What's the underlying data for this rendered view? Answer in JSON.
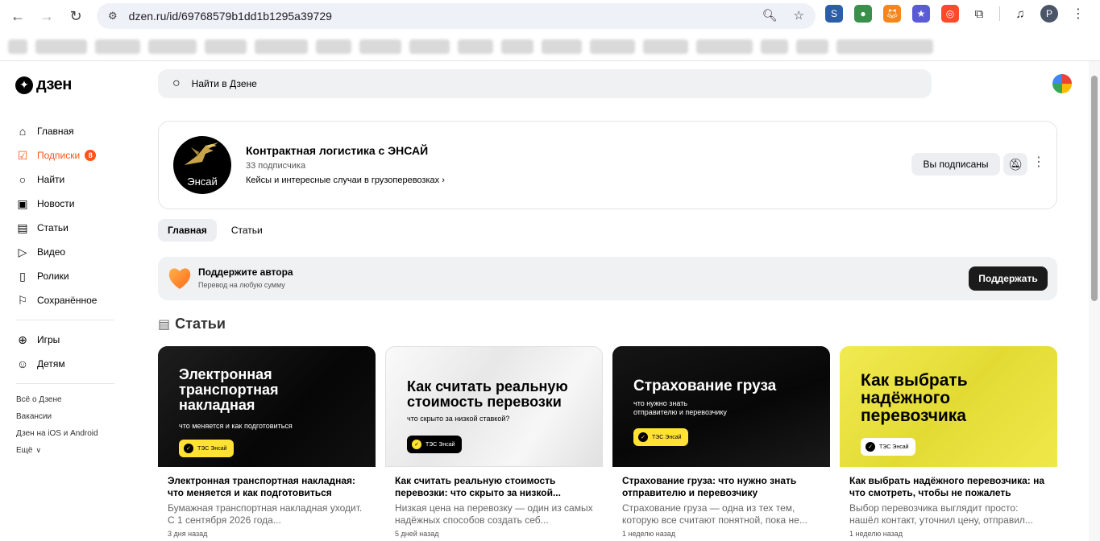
{
  "browser": {
    "url": "dzen.ru/id/69768579b1dd1b1295a39729",
    "profile_initial": "P"
  },
  "site": {
    "logo_text": "дзен"
  },
  "search": {
    "placeholder": "Найти в Дзене"
  },
  "sidebar": {
    "items": [
      {
        "label": "Главная",
        "icon": "home-icon"
      },
      {
        "label": "Подписки",
        "icon": "subscriptions-icon",
        "badge": "8",
        "active": true
      },
      {
        "label": "Найти",
        "icon": "search-icon"
      },
      {
        "label": "Новости",
        "icon": "news-icon"
      },
      {
        "label": "Статьи",
        "icon": "articles-icon"
      },
      {
        "label": "Видео",
        "icon": "video-icon"
      },
      {
        "label": "Ролики",
        "icon": "clips-icon"
      },
      {
        "label": "Сохранённое",
        "icon": "bookmark-icon"
      }
    ],
    "extra": [
      {
        "label": "Игры",
        "icon": "gamepad-icon"
      },
      {
        "label": "Детям",
        "icon": "kids-icon"
      }
    ],
    "footer": [
      "Всё о Дзене",
      "Вакансии",
      "Дзен на iOS и Android",
      "Ещё"
    ]
  },
  "channel": {
    "avatar_text": "Энсай",
    "title": "Контрактная логистика с ЭНСАЙ",
    "subscribers": "33 подписчика",
    "description": "Кейсы и интересные случаи в грузоперевозках",
    "subscribed_label": "Вы подписаны"
  },
  "tabs": [
    {
      "label": "Главная",
      "active": true
    },
    {
      "label": "Статьи",
      "active": false
    }
  ],
  "support": {
    "title": "Поддержите автора",
    "subtitle": "Перевод на любую сумму",
    "button": "Поддержать"
  },
  "articles_section": {
    "title": "Статьи"
  },
  "articles": [
    {
      "thumb_title": "Электронная\nтранспортная\nнакладная",
      "thumb_subtitle": "что меняется и как подготовиться",
      "pill": "ТЭС Энсай",
      "title": "Электронная транспортная накладная: что меняется и как подготовиться",
      "description": "Бумажная транспортная накладная уходит. С 1 сентября 2026 года...",
      "time": "3 дня назад"
    },
    {
      "thumb_title": "Как считать реальную\nстоимость перевозки",
      "thumb_subtitle": "что скрыто за низкой ставкой?",
      "pill": "ТЭС Энсай",
      "title": "Как считать реальную стоимость перевозки: что скрыто за низкой...",
      "description": "Низкая цена на перевозку — один из самых надёжных способов создать себ...",
      "time": "5 дней назад"
    },
    {
      "thumb_title": "Страхование груза",
      "thumb_subtitle": "что нужно знать\nотправителю и перевозчику",
      "pill": "ТЭС Энсай",
      "title": "Страхование груза: что нужно знать отправителю и перевозчику",
      "description": "Страхование груза — одна из тех тем, которую все считают понятной, пока не...",
      "time": "1 неделю назад"
    },
    {
      "thumb_title": "Как выбрать\nнадёжного\nперевозчика",
      "thumb_subtitle": "",
      "pill": "ТЭС Энсай",
      "title": "Как выбрать надёжного перевозчика: на что смотреть, чтобы не пожалеть",
      "description": "Выбор перевозчика выглядит просто: нашёл контакт, уточнил цену, отправил...",
      "time": "1 неделю назад"
    }
  ]
}
